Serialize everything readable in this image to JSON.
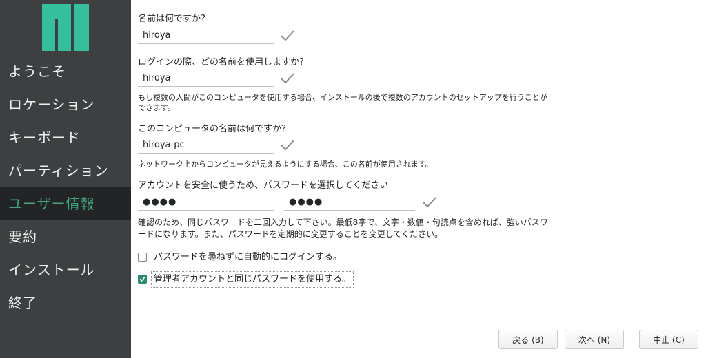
{
  "sidebar": {
    "logo": "manjaro-logo",
    "items": [
      {
        "label": "ようこそ",
        "active": false
      },
      {
        "label": "ロケーション",
        "active": false
      },
      {
        "label": "キーボード",
        "active": false
      },
      {
        "label": "パーティション",
        "active": false
      },
      {
        "label": "ユーザー情報",
        "active": true
      },
      {
        "label": "要約",
        "active": false
      },
      {
        "label": "インストール",
        "active": false
      },
      {
        "label": "終了",
        "active": false
      }
    ]
  },
  "form": {
    "name_label": "名前は何ですか?",
    "name_value": "hiroya",
    "login_label": "ログインの際、どの名前を使用しますか?",
    "login_value": "hiroya",
    "login_hint": "もし複数の人間がこのコンピュータを使用する場合、インストールの後で複数のアカウントのセットアップを行うことができます。",
    "hostname_label": "このコンピュータの名前は何ですか？",
    "hostname_value": "hiroya-pc",
    "hostname_hint": "ネットワーク上からコンピュータが見えるようにする場合、この名前が使用されます。",
    "password_label": "アカウントを安全に使うため、パスワードを選択してください",
    "password_value": "●●●●",
    "password_confirm_value": "●●●●",
    "password_hint": "確認のため、同じパスワードを二回入力して下さい。最低8字で、文字・数値・句読点を含めれば、強いパスワードになります。また、パスワードを定期的に変更することを変更してください。",
    "autologin_label": "パスワードを尋ねずに自動的にログインする。",
    "autologin_checked": false,
    "admin_same_label": "管理者アカウントと同じパスワードを使用する。",
    "admin_same_checked": true,
    "valid_icon": "checkmark-icon"
  },
  "buttons": {
    "back": "戻る (B)",
    "next": "次へ (N)",
    "cancel": "中止 (C)"
  },
  "colors": {
    "sidebar_bg": "#3d3f40",
    "sidebar_active_bg": "#232425",
    "accent": "#40a785",
    "logo_green": "#35bf5c"
  }
}
